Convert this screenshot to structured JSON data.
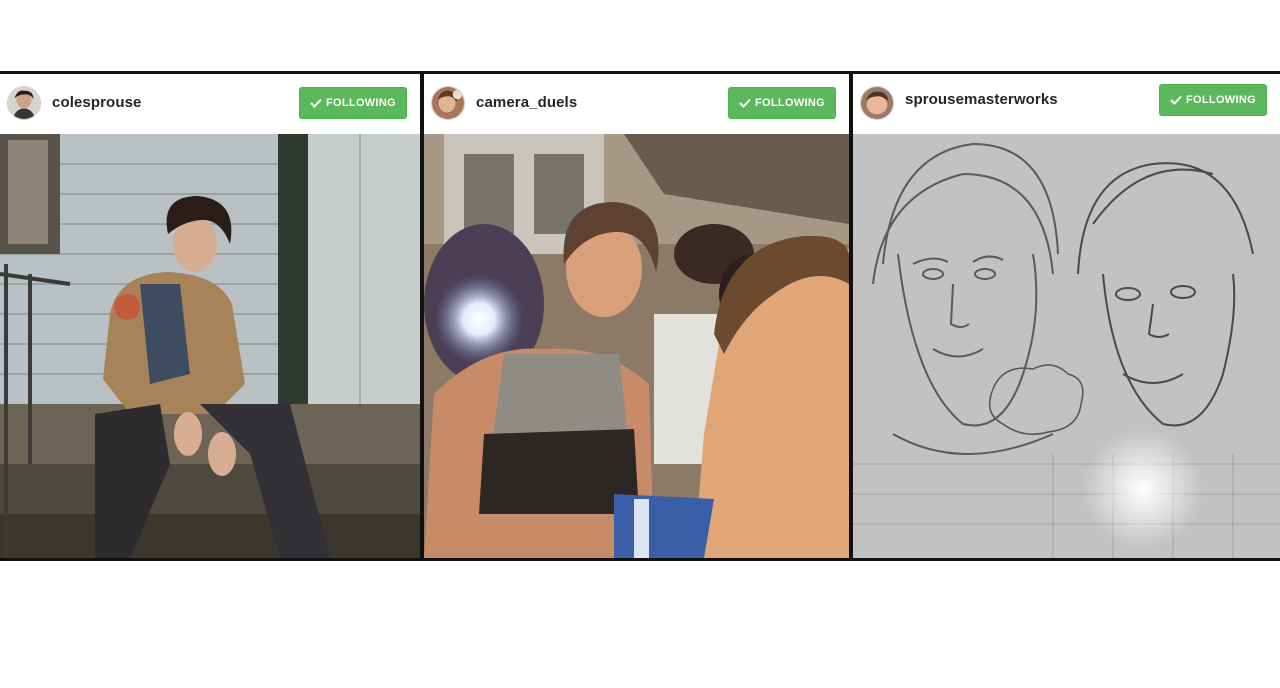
{
  "posts": [
    {
      "username": "colesprouse",
      "follow_label": "FOLLOWING",
      "avatar_icon": "profile-photo",
      "image_icon": "photo-man-sitting-on-porch-steps"
    },
    {
      "username": "camera_duels",
      "follow_label": "FOLLOWING",
      "avatar_icon": "profile-photo",
      "image_icon": "photo-selfie-on-subway-train"
    },
    {
      "username": "sprousemasterworks",
      "follow_label": "FOLLOWING",
      "avatar_icon": "profile-photo",
      "image_icon": "photo-pencil-drawing-of-two-faces"
    }
  ],
  "colors": {
    "follow_button": "#5cb85c",
    "username_text": "#262626",
    "divider": "#111111"
  }
}
